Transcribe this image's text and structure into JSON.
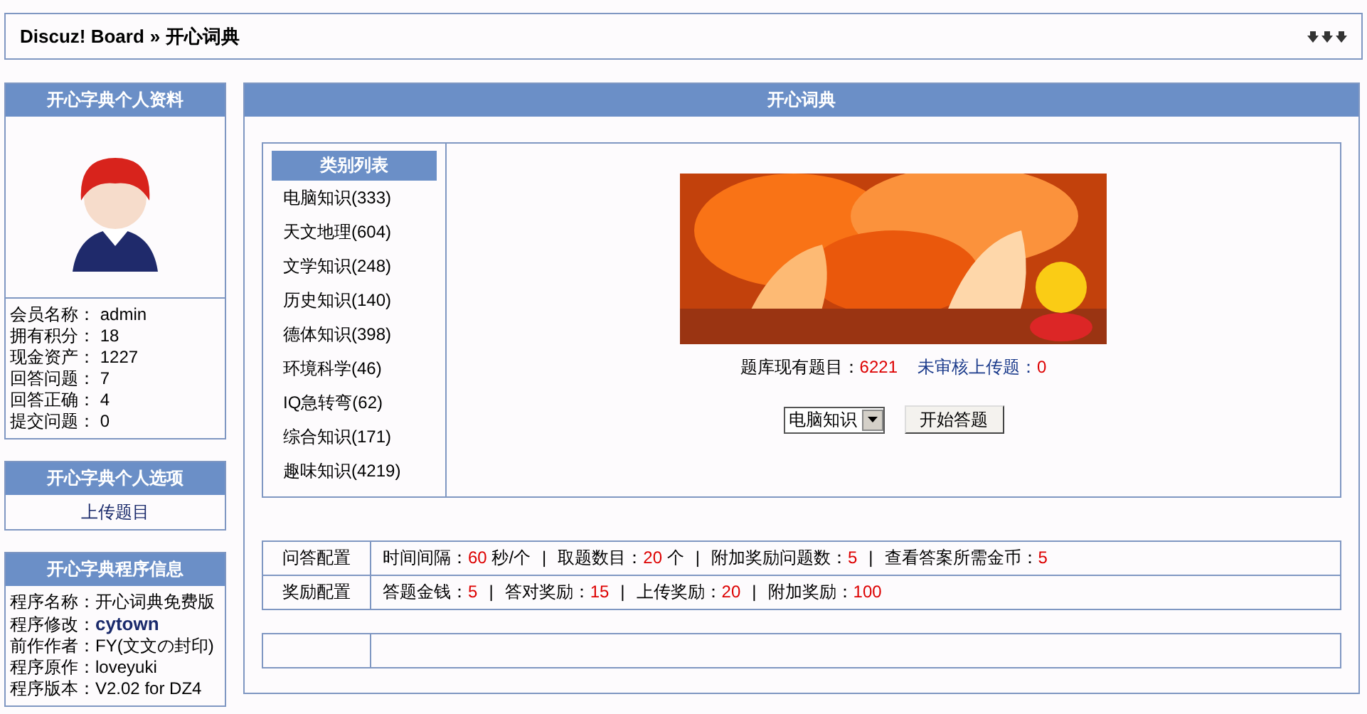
{
  "breadcrumb": {
    "site": "Discuz! Board",
    "separator": "»",
    "current": "开心词典"
  },
  "profile": {
    "title": "开心字典个人资料",
    "fields": [
      {
        "label": "会员名称：",
        "value": "admin"
      },
      {
        "label": "拥有积分：",
        "value": "18"
      },
      {
        "label": "现金资产：",
        "value": "1227"
      },
      {
        "label": "回答问题：",
        "value": "7"
      },
      {
        "label": "回答正确：",
        "value": "4"
      },
      {
        "label": "提交问题：",
        "value": "0"
      }
    ]
  },
  "options": {
    "title": "开心字典个人选项",
    "links": [
      "上传题目"
    ]
  },
  "program_info": {
    "title": "开心字典程序信息",
    "fields": [
      {
        "label": "程序名称：",
        "value": "开心词典免费版",
        "bold": false
      },
      {
        "label": "程序修改：",
        "value": "cytown",
        "bold": true
      },
      {
        "label": "前作作者：",
        "value": "FY(文文の封印)",
        "bold": false
      },
      {
        "label": "程序原作：",
        "value": "loveyuki",
        "bold": false
      },
      {
        "label": "程序版本：",
        "value": "V2.02 for DZ4",
        "bold": false
      }
    ]
  },
  "main": {
    "title": "开心词典",
    "categories": {
      "title": "类别列表",
      "items": [
        "电脑知识(333)",
        "天文地理(604)",
        "文学知识(248)",
        "历史知识(140)",
        "德体知识(398)",
        "环境科学(46)",
        "IQ急转弯(62)",
        "综合知识(171)",
        "趣味知识(4219)"
      ]
    },
    "stats": [
      {
        "label": "题库现有题目：",
        "value": "6221"
      },
      {
        "label": "未审核上传题：",
        "value": "0"
      }
    ],
    "category_select": {
      "value": "电脑知识"
    },
    "start_button": "开始答题",
    "config": [
      {
        "label": "问答配置",
        "separator": "|",
        "items": [
          {
            "label": "时间间隔：",
            "value": "60",
            "unit": "秒/个"
          },
          {
            "label": "取题数目：",
            "value": "20",
            "unit": "个"
          },
          {
            "label": "附加奖励问题数：",
            "value": "5"
          },
          {
            "label": "查看答案所需金币：",
            "value": "5"
          }
        ]
      },
      {
        "label": "奖励配置",
        "separator": "|",
        "items": [
          {
            "label": "答题金钱：",
            "value": "5"
          },
          {
            "label": "答对奖励：",
            "value": "15"
          },
          {
            "label": "上传奖励：",
            "value": "20"
          },
          {
            "label": "附加奖励：",
            "value": "100"
          }
        ]
      }
    ]
  }
}
